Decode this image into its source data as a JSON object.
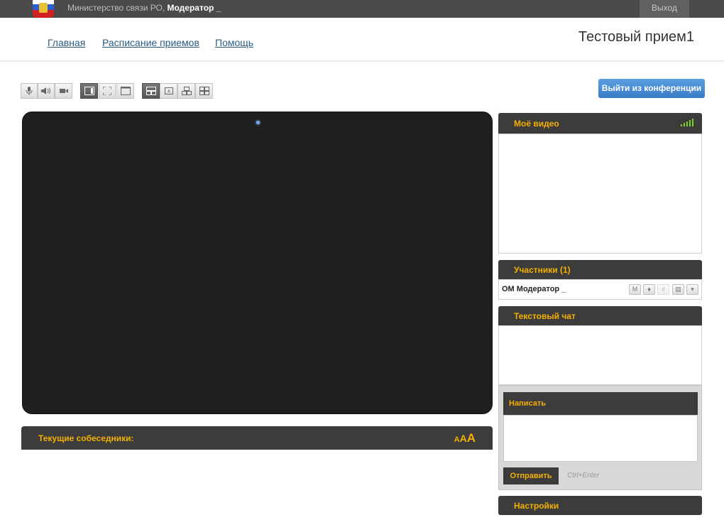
{
  "topbar": {
    "org_prefix": "Министерство связи РО,",
    "user": "Модератор _",
    "exit_label": "Выход"
  },
  "nav": {
    "items": [
      "Главная",
      "Расписание приемов",
      "Помощь"
    ]
  },
  "room_title": "Тестовый прием1",
  "toolbar": {
    "leave_label": "Выйти из конференции"
  },
  "current": {
    "label": "Текущие собеседники:",
    "font_sizes": [
      "A",
      "A",
      "A"
    ]
  },
  "panels": {
    "my_video": "Моё видео",
    "participants": "Участники (1)",
    "participant_name": "ОМ Модератор _",
    "chat": "Текстовый чат",
    "compose": "Написать",
    "send_label": "Отправить",
    "send_hint": "Ctrl+Enter",
    "settings": "Настройки"
  },
  "colors": {
    "accent": "#f5b000",
    "dark_panel": "#3c3c3c",
    "link": "#2a5c84",
    "primary_button": "#3a7dc8",
    "signal": "#7ed31b"
  }
}
